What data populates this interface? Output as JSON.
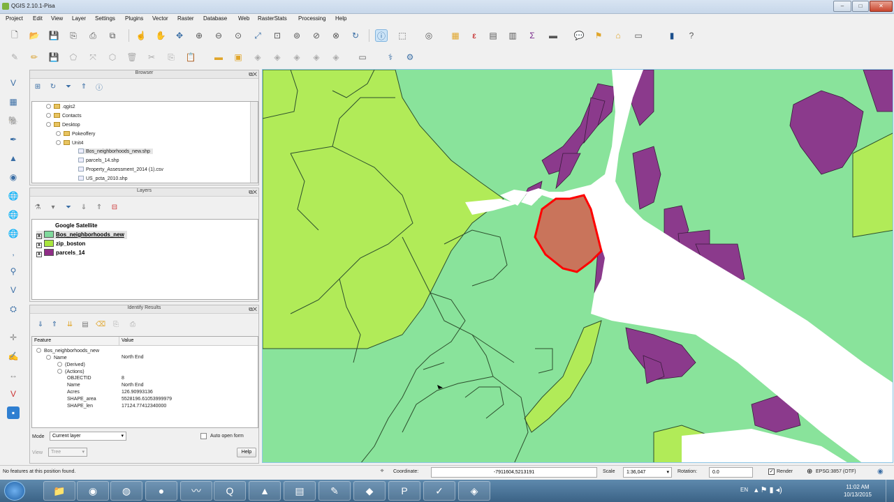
{
  "window": {
    "title": "QGIS 2.10.1-Pisa"
  },
  "menu": [
    "Project",
    "Edit",
    "View",
    "Layer",
    "Settings",
    "Plugins",
    "Vector",
    "Raster",
    "Database",
    "Web",
    "RasterStats",
    "Processing",
    "Help"
  ],
  "browser": {
    "title": "Browser",
    "items": [
      ".qgis2",
      "Contacts",
      "Desktop",
      "Pokeoffery",
      "Unit4",
      "Bos_neighborhoods_new.shp",
      "parcels_14.shp",
      "Property_Assessment_2014 (1).csv",
      "US_pcta_2010.shp"
    ]
  },
  "layers": {
    "title": "Layers",
    "items": [
      {
        "name": "Google Satellite",
        "checked": "",
        "color": ""
      },
      {
        "name": "Bos_neighborhoods_new",
        "checked": "x",
        "color": "#7fd99c"
      },
      {
        "name": "zip_boston",
        "checked": "x",
        "color": "#a8e63e"
      },
      {
        "name": "parcels_14",
        "checked": "x",
        "color": "#8f2d86"
      }
    ]
  },
  "identify": {
    "title": "Identify Results",
    "col_feature": "Feature",
    "col_value": "Value",
    "layer": "Bos_neighborhoods_new",
    "name_label": "Name",
    "name_value": "North End",
    "derived": "(Derived)",
    "actions": "(Actions)",
    "attrs": [
      {
        "k": "OBJECTID",
        "v": "8"
      },
      {
        "k": "Name",
        "v": "North End"
      },
      {
        "k": "Acres",
        "v": "126.90993136"
      },
      {
        "k": "SHAPE_area",
        "v": "5528196.61053999979"
      },
      {
        "k": "SHAPE_len",
        "v": "17124.77412340000"
      }
    ],
    "mode_label": "Mode",
    "mode_value": "Current layer",
    "auto_open": "Auto open form",
    "view_label": "View",
    "view_value": "Tree",
    "help": "Help"
  },
  "status": {
    "message": "No features at this position found.",
    "coordinate_label": "Coordinate:",
    "coordinate_value": "-7911604,5213191",
    "scale_label": "Scale",
    "scale_value": "1:36,047",
    "rotation_label": "Rotation:",
    "rotation_value": "0.0",
    "render_label": "Render",
    "crs": "EPSG:3857 (OTF)"
  },
  "taskbar": {
    "time": "11:02 AM",
    "date": "10/13/2015",
    "lang": "EN"
  },
  "colors": {
    "neighborhood": "#89e39b",
    "zip": "#b1eb58",
    "parcel": "#8b3a8c",
    "selected_fill": "#c9745b",
    "selected_stroke": "#ff0000",
    "water": "#ffffff"
  }
}
